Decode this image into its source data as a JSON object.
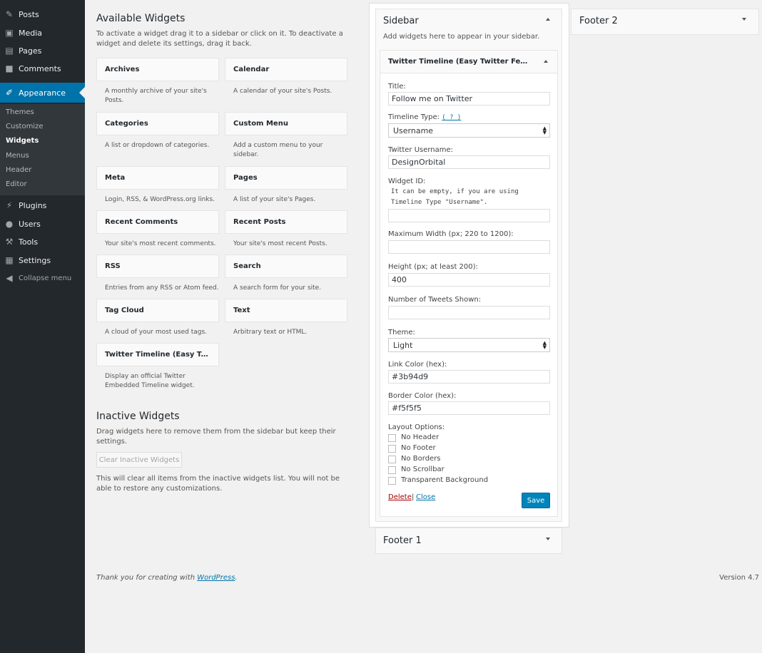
{
  "admin_menu": {
    "items": [
      {
        "label": "Posts",
        "icon": "pin-icon"
      },
      {
        "label": "Media",
        "icon": "media-icon"
      },
      {
        "label": "Pages",
        "icon": "page-icon"
      },
      {
        "label": "Comments",
        "icon": "comment-icon"
      },
      {
        "label": "Appearance",
        "icon": "brush-icon"
      },
      {
        "label": "Plugins",
        "icon": "plugin-icon"
      },
      {
        "label": "Users",
        "icon": "user-icon"
      },
      {
        "label": "Tools",
        "icon": "wrench-icon"
      },
      {
        "label": "Settings",
        "icon": "settings-icon"
      },
      {
        "label": "Collapse menu",
        "icon": "collapse-icon"
      }
    ],
    "submenu": [
      "Themes",
      "Customize",
      "Widgets",
      "Menus",
      "Header",
      "Editor"
    ]
  },
  "available": {
    "title": "Available Widgets",
    "desc": "To activate a widget drag it to a sidebar or click on it. To deactivate a widget and delete its settings, drag it back.",
    "widgets": [
      {
        "title": "Archives",
        "desc": "A monthly archive of your site's Posts."
      },
      {
        "title": "Calendar",
        "desc": "A calendar of your site's Posts."
      },
      {
        "title": "Categories",
        "desc": "A list or dropdown of categories."
      },
      {
        "title": "Custom Menu",
        "desc": "Add a custom menu to your sidebar."
      },
      {
        "title": "Meta",
        "desc": "Login, RSS, & WordPress.org links."
      },
      {
        "title": "Pages",
        "desc": "A list of your site's Pages."
      },
      {
        "title": "Recent Comments",
        "desc": "Your site's most recent comments."
      },
      {
        "title": "Recent Posts",
        "desc": "Your site's most recent Posts."
      },
      {
        "title": "RSS",
        "desc": "Entries from any RSS or Atom feed."
      },
      {
        "title": "Search",
        "desc": "A search form for your site."
      },
      {
        "title": "Tag Cloud",
        "desc": "A cloud of your most used tags."
      },
      {
        "title": "Text",
        "desc": "Arbitrary text or HTML."
      },
      {
        "title": "Twitter Timeline (Easy Twitter Feed Widget)",
        "desc": "Display an official Twitter Embedded Timeline widget."
      }
    ]
  },
  "inactive": {
    "title": "Inactive Widgets",
    "desc": "Drag widgets here to remove them from the sidebar but keep their settings.",
    "clear_button": "Clear Inactive Widgets",
    "note": "This will clear all items from the inactive widgets list. You will not be able to restore any customizations."
  },
  "sidebar": {
    "title": "Sidebar",
    "desc": "Add widgets here to appear in your sidebar.",
    "widget_title": "Twitter Timeline (Easy Twitter Feed Widget)",
    "form": {
      "title_label": "Title:",
      "title_value": "Follow me on Twitter",
      "type_label": "Timeline Type:",
      "type_help": "( ? )",
      "type_value": "Username",
      "username_label": "Twitter Username:",
      "username_value": "DesignOrbital",
      "widget_id_label": "Widget ID:",
      "widget_id_note": "It can be empty, if you are using\nTimeline Type \"Username\".",
      "widget_id_value": "",
      "width_label": "Maximum Width (px; 220 to 1200):",
      "width_value": "",
      "height_label": "Height (px; at least 200):",
      "height_value": "400",
      "tweets_label": "Number of Tweets Shown:",
      "tweets_value": "",
      "theme_label": "Theme:",
      "theme_value": "Light",
      "link_label": "Link Color (hex):",
      "link_value": "#3b94d9",
      "border_label": "Border Color (hex):",
      "border_value": "#f5f5f5",
      "layout_label": "Layout Options:",
      "layout_options": [
        "No Header",
        "No Footer",
        "No Borders",
        "No Scrollbar",
        "Transparent Background"
      ],
      "delete": "Delete",
      "separator": "|",
      "close": "Close",
      "save": "Save"
    }
  },
  "footer1": {
    "title": "Footer 1"
  },
  "footer2": {
    "title": "Footer 2"
  },
  "page_footer": {
    "thanks_prefix": "Thank you for creating with ",
    "thanks_link": "WordPress",
    "thanks_suffix": ".",
    "version": "Version 4.7"
  },
  "colors": {
    "accent": "#0073aa",
    "sidebar_bg": "#23282d",
    "save_button": "#0085ba"
  }
}
